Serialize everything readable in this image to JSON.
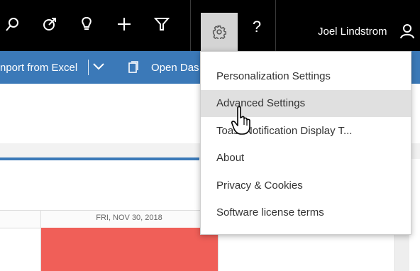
{
  "topbar": {
    "icons": [
      "search-icon",
      "target-icon",
      "lightbulb-icon",
      "plus-icon",
      "filter-icon",
      "gear-icon"
    ],
    "help_label": "?",
    "user_name": "Joel Lindstrom",
    "user_icon": "person-icon"
  },
  "command_bar": {
    "import_label": "nport from Excel",
    "dropdown_icon": "chevron-down-icon",
    "open_icon": "document-icon",
    "open_label": "Open Das"
  },
  "calendar": {
    "date_header": "FRI, NOV 30, 2018",
    "event_color": "#f05f58"
  },
  "settings_menu": {
    "items": [
      "Personalization Settings",
      "Advanced Settings",
      "Toast Notification Display T...",
      "About",
      "Privacy & Cookies",
      "Software license terms"
    ],
    "hovered_index": 1
  },
  "colors": {
    "topbar": "#000000",
    "command_bar": "#3b79b8",
    "active_settings_button": "#d4d4d4",
    "menu_hover": "#e0e0e0"
  }
}
